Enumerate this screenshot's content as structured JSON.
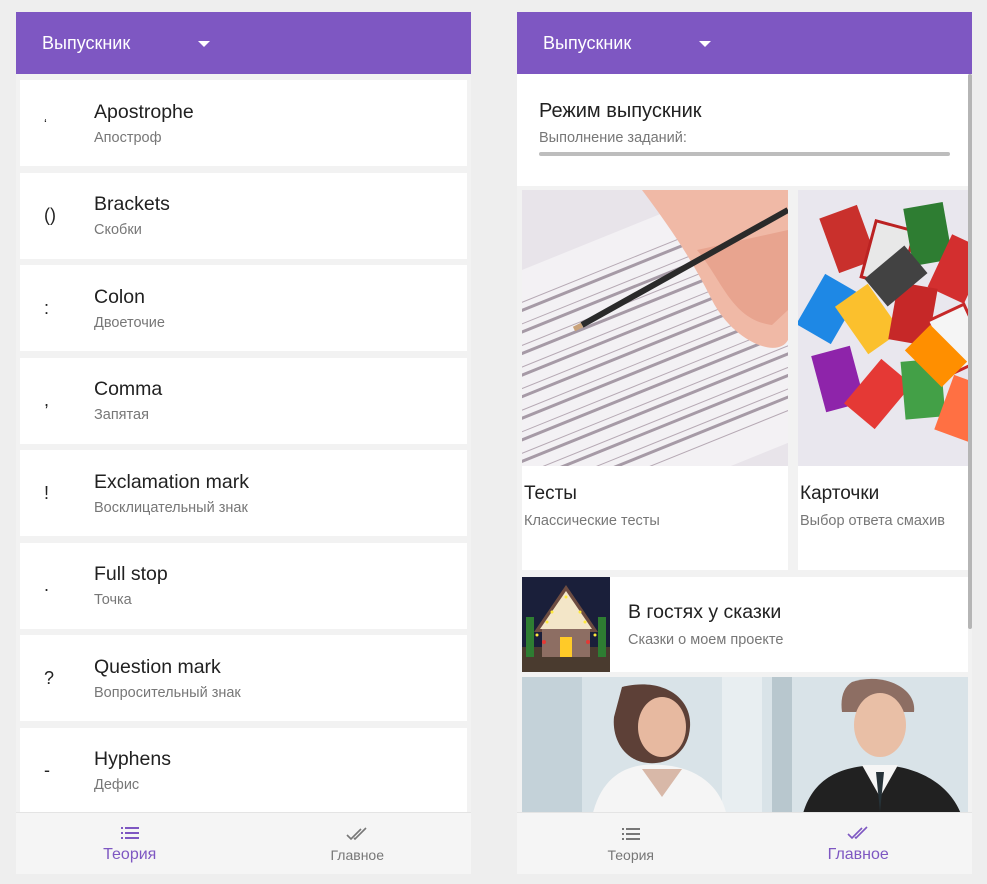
{
  "left_screen": {
    "appbar": {
      "title": "Выпускник"
    },
    "items": [
      {
        "symbol": "‘",
        "en": "Apostrophe",
        "ru": "Апостроф"
      },
      {
        "symbol": "()",
        "en": "Brackets",
        "ru": "Скобки"
      },
      {
        "symbol": ":",
        "en": "Colon",
        "ru": "Двоеточие"
      },
      {
        "symbol": ",",
        "en": "Comma",
        "ru": "Запятая"
      },
      {
        "symbol": "!",
        "en": "Exclamation mark",
        "ru": "Восклицательный знак"
      },
      {
        "symbol": ".",
        "en": "Full stop",
        "ru": "Точка"
      },
      {
        "symbol": "?",
        "en": "Question mark",
        "ru": "Вопросительный знак"
      },
      {
        "symbol": "-",
        "en": "Hyphens",
        "ru": "Дефис"
      }
    ],
    "nav": {
      "theory": "Теория",
      "main": "Главное",
      "active": "theory"
    }
  },
  "right_screen": {
    "appbar": {
      "title": "Выпускник"
    },
    "header": {
      "title": "Режим выпускник",
      "progress_label": "Выполнение заданий:",
      "progress": 0
    },
    "cards": [
      {
        "title": "Тесты",
        "subtitle": "Классические тесты"
      },
      {
        "title": "Карточки",
        "subtitle": "Выбор ответа смахив"
      }
    ],
    "fairy": {
      "title": "В гостях у сказки",
      "subtitle": "Сказки о моем проекте"
    },
    "nav": {
      "theory": "Теория",
      "main": "Главное",
      "active": "main"
    }
  },
  "colors": {
    "primary": "#7e57c2",
    "nav_inactive": "#777777"
  },
  "icons": {
    "theory": "list-icon",
    "main": "double-check-icon",
    "dropdown": "caret-down-icon"
  }
}
